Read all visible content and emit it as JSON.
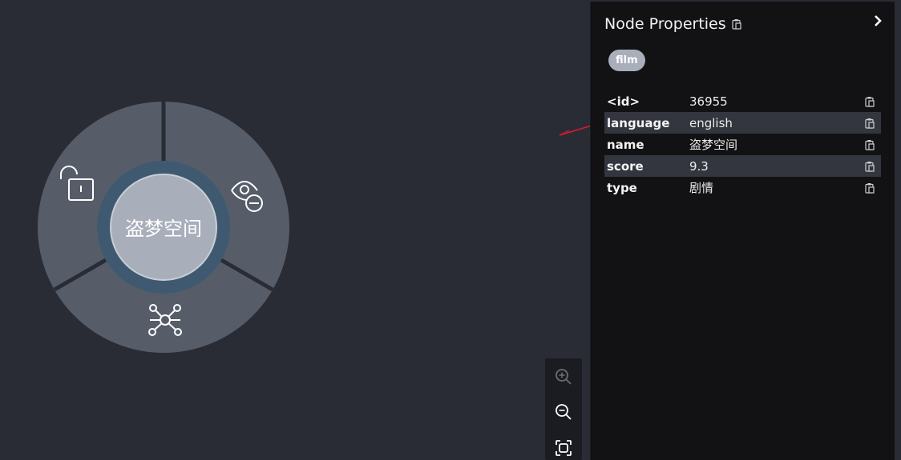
{
  "graph": {
    "node_label": "盗梦空间",
    "menu_actions": [
      {
        "icon": "unlock-icon",
        "action": "unlock"
      },
      {
        "icon": "eye-minus-icon",
        "action": "hide"
      },
      {
        "icon": "network-icon",
        "action": "expand"
      }
    ]
  },
  "zoom": {
    "zoom_in_icon": "zoom-in-icon",
    "zoom_out_icon": "zoom-out-icon",
    "fit_icon": "fit-to-screen-icon"
  },
  "panel": {
    "title": "Node Properties",
    "label_chip": "film",
    "properties": [
      {
        "key": "<id>",
        "value": "36955"
      },
      {
        "key": "language",
        "value": "english"
      },
      {
        "key": "name",
        "value": "盗梦空间"
      },
      {
        "key": "score",
        "value": "9.3"
      },
      {
        "key": "type",
        "value": "剧情"
      }
    ]
  },
  "colors": {
    "background": "#292c35",
    "menu_ring": "#575c69",
    "node_fill": "#a9aebb",
    "node_halo": "#3f5a70",
    "panel_bg": "#121215",
    "annotation_arrow": "#d81e2a"
  }
}
